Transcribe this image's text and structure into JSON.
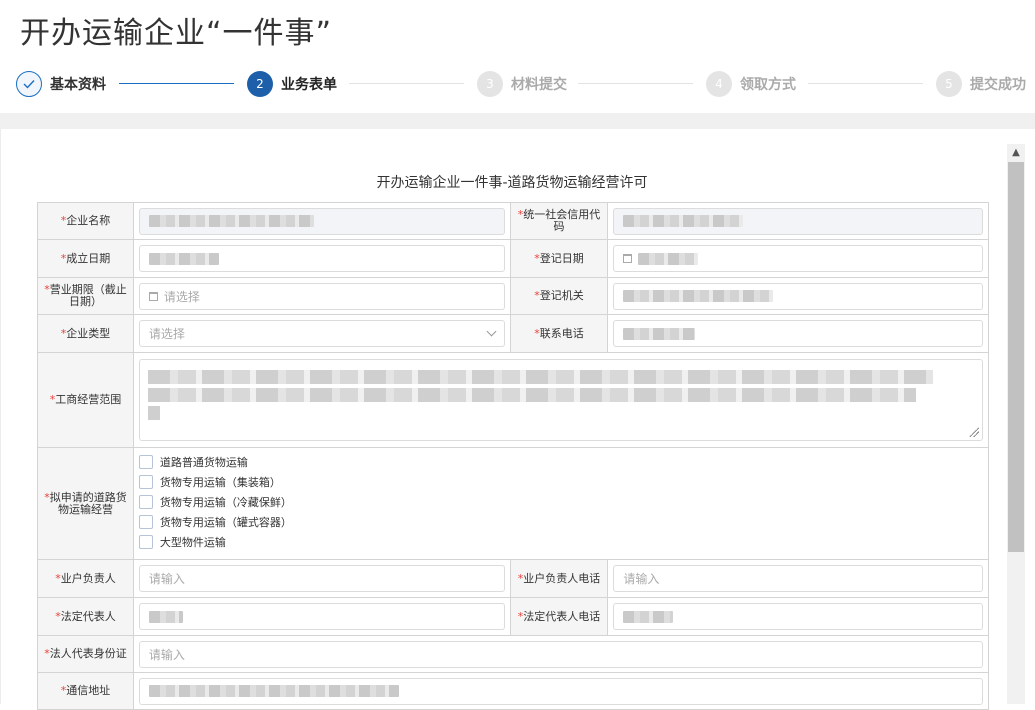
{
  "page": {
    "title": "开办运输企业“一件事”"
  },
  "steps": [
    {
      "num": "",
      "label": "基本资料",
      "state": "done"
    },
    {
      "num": "2",
      "label": "业务表单",
      "state": "active"
    },
    {
      "num": "3",
      "label": "材料提交",
      "state": "todo"
    },
    {
      "num": "4",
      "label": "领取方式",
      "state": "todo"
    },
    {
      "num": "5",
      "label": "提交成功",
      "state": "todo"
    }
  ],
  "form": {
    "title": "开办运输企业一件事-道路货物运输经营许可",
    "required_mark": "*",
    "company_name": {
      "label": "企业名称"
    },
    "credit_code": {
      "label": "统一社会信用代码"
    },
    "found_date": {
      "label": "成立日期"
    },
    "register_date": {
      "label": "登记日期"
    },
    "business_term": {
      "label": "营业期限（截止日期）",
      "placeholder": "请选择"
    },
    "register_authority": {
      "label": "登记机关"
    },
    "company_type": {
      "label": "企业类型",
      "placeholder": "请选择"
    },
    "contact_phone": {
      "label": "联系电话"
    },
    "business_scope": {
      "label": "工商经营范围"
    },
    "transport_type": {
      "label": "拟申请的道路货物运输经营",
      "options": [
        "道路普通货物运输",
        "货物专用运输（集装箱）",
        "货物专用运输（冷藏保鲜）",
        "货物专用运输（罐式容器）",
        "大型物件运输"
      ]
    },
    "owner_name": {
      "label": "业户负责人",
      "placeholder": "请输入"
    },
    "owner_phone": {
      "label": "业户负责人电话",
      "placeholder": "请输入"
    },
    "legal_rep": {
      "label": "法定代表人"
    },
    "legal_rep_phone": {
      "label": "法定代表人电话"
    },
    "legal_rep_id": {
      "label": "法人代表身份证",
      "placeholder": "请输入"
    },
    "address": {
      "label": "通信地址"
    }
  },
  "colors": {
    "primary": "#1d5fa8",
    "required": "#e8413b"
  }
}
